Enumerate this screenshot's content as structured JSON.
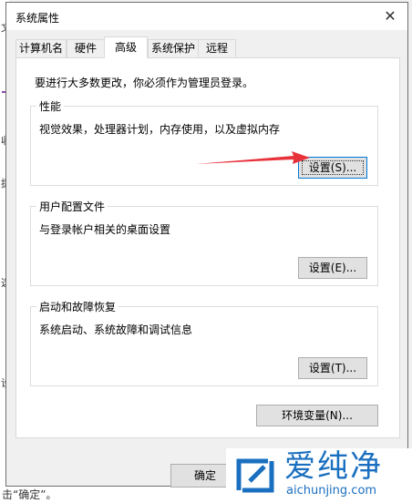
{
  "window": {
    "title": "系统属性",
    "close_glyph": "✕",
    "tabs": [
      {
        "label": "计算机名"
      },
      {
        "label": "硬件"
      },
      {
        "label": "高级"
      },
      {
        "label": "系统保护"
      },
      {
        "label": "远程"
      }
    ],
    "admin_note": "要进行大多数更改，你必须作为管理员登录。",
    "performance": {
      "title": "性能",
      "desc": "视觉效果，处理器计划，内存使用，以及虚拟内存",
      "button": "设置(S)..."
    },
    "user_profile": {
      "title": "用户配置文件",
      "desc": "与登录帐户相关的桌面设置",
      "button": "设置(E)..."
    },
    "startup": {
      "title": "启动和故障恢复",
      "desc": "系统启动、系统故障和调试信息",
      "button": "设置(T)..."
    },
    "env_button": "环境变量(N)...",
    "ok_button": "确定"
  },
  "background": {
    "chars": [
      "文",
      "收",
      "提",
      "选",
      "设"
    ],
    "bottom_text": "击“确定”。"
  },
  "watermark": {
    "brand": "爱纯净",
    "url": "aichunjing.com"
  },
  "colors": {
    "arrow": "#e8323a",
    "logo_blue": "#1a6fc0",
    "focus_blue": "#0078d7"
  }
}
